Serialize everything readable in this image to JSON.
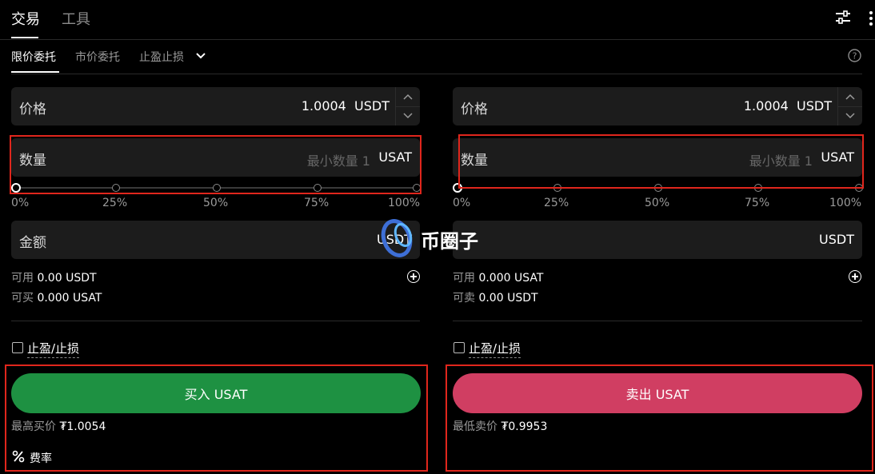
{
  "top_tabs": [
    "交易",
    "工具"
  ],
  "order_tabs": [
    "限价委托",
    "市价委托",
    "止盈止损"
  ],
  "buy": {
    "price_label": "价格",
    "price_value": "1.0004",
    "price_unit": "USDT",
    "qty_label": "数量",
    "qty_placeholder": "最小数量 1",
    "qty_unit": "USAT",
    "percents": [
      "0%",
      "25%",
      "50%",
      "75%",
      "100%"
    ],
    "amount_label": "金额",
    "amount_unit": "USDT",
    "avail_label": "可用",
    "avail_value": "0.00 USDT",
    "can_label": "可买",
    "can_value": "0.000 USAT",
    "tpsl_label": "止盈/止损",
    "button": "买入 USAT",
    "best_label": "最高买价",
    "best_value": "₮1.0054",
    "fee_label": "费率"
  },
  "sell": {
    "price_label": "价格",
    "price_value": "1.0004",
    "price_unit": "USDT",
    "qty_label": "数量",
    "qty_placeholder": "最小数量 1",
    "qty_unit": "USAT",
    "percents": [
      "0%",
      "25%",
      "50%",
      "75%",
      "100%"
    ],
    "amount_unit": "USDT",
    "avail_label": "可用",
    "avail_value": "0.000 USAT",
    "can_label": "可卖",
    "can_value": "0.00 USDT",
    "tpsl_label": "止盈/止损",
    "button": "卖出 USAT",
    "best_label": "最低卖价",
    "best_value": "₮0.9953"
  },
  "watermark": "币圈子",
  "colors": {
    "buy": "#1e9142",
    "sell": "#d03e62",
    "highlight": "#e0261c"
  }
}
